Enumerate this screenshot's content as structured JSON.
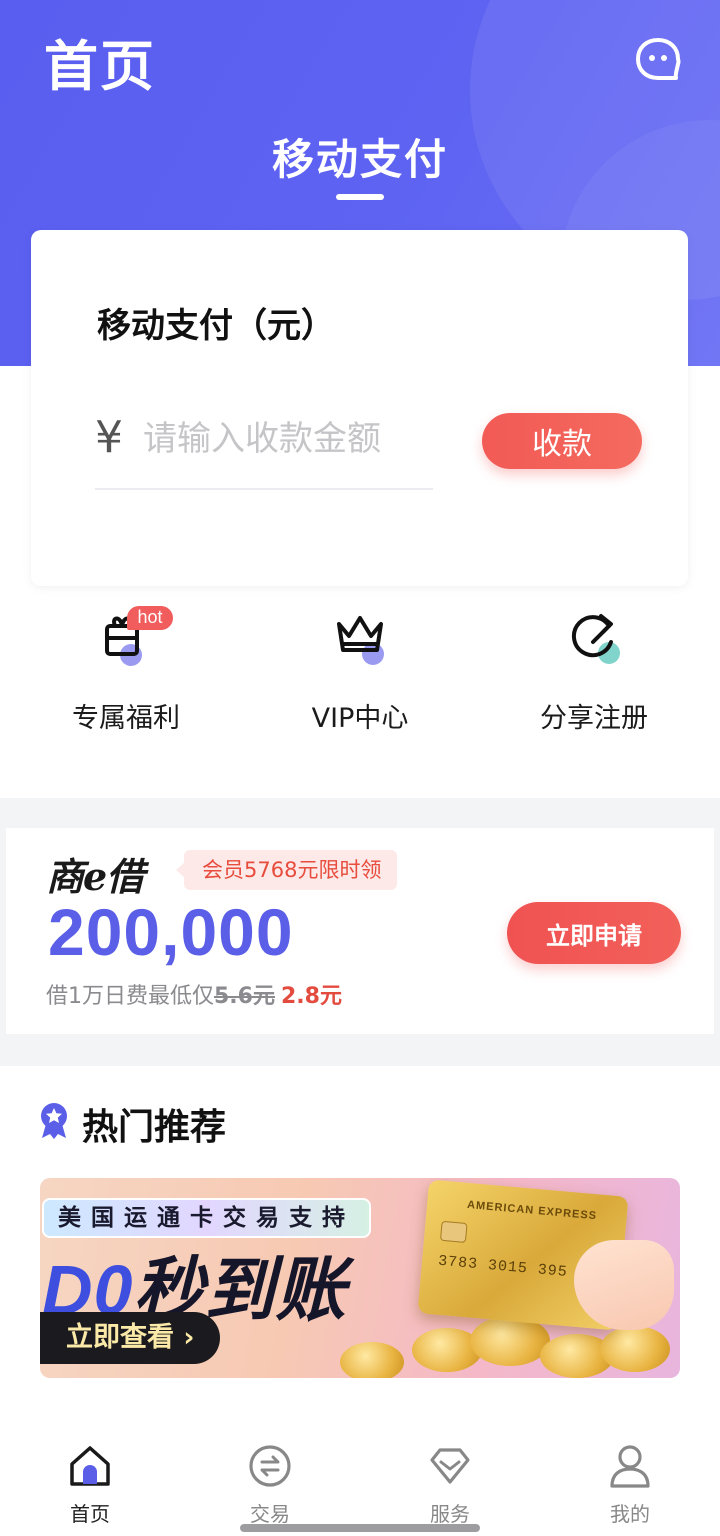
{
  "header": {
    "title": "首页",
    "active_tab": "移动支付"
  },
  "pay_card": {
    "title": "移动支付（元）",
    "currency_symbol": "¥",
    "amount_placeholder": "请输入收款金额",
    "collect_label": "收款"
  },
  "quick_actions": [
    {
      "label": "专属福利",
      "badge": "hot",
      "icon": "gift-icon"
    },
    {
      "label": "VIP中心",
      "icon": "crown-icon"
    },
    {
      "label": "分享注册",
      "icon": "refresh-share-icon"
    }
  ],
  "loan": {
    "logo": "商e借",
    "tag": "会员5768元限时领",
    "amount": "200,000",
    "desc_prefix": "借1万日费最低仅",
    "old_price": "5.6元",
    "new_price": "2.8元",
    "apply_label": "立即申请"
  },
  "recommend": {
    "title": "热门推荐",
    "banner": {
      "top_text": "美国运通卡交易支持",
      "main_en": "D0",
      "main_cn": "秒到账",
      "button_label": "立即查看 ›",
      "card_brand": "AMERICAN EXPRESS",
      "card_number": "3783 3015 395"
    }
  },
  "tabbar": [
    {
      "label": "首页",
      "icon": "home-icon",
      "active": true
    },
    {
      "label": "交易",
      "icon": "exchange-icon",
      "active": false
    },
    {
      "label": "服务",
      "icon": "diamond-icon",
      "active": false
    },
    {
      "label": "我的",
      "icon": "user-icon",
      "active": false
    }
  ],
  "colors": {
    "primary": "#5a5ef0",
    "accent_red": "#f25a55",
    "amount_blue": "#5b5fe8"
  }
}
